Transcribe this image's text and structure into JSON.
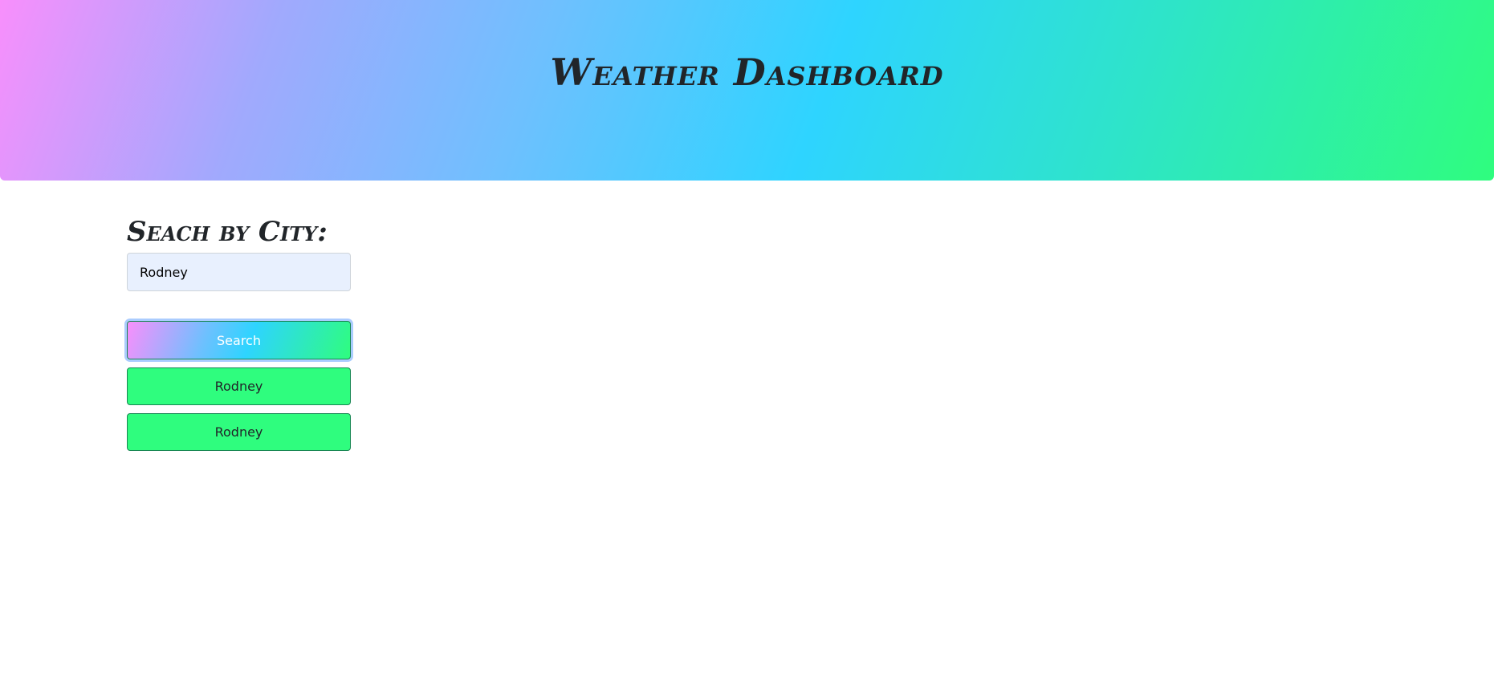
{
  "header": {
    "title": "Weather Dashboard"
  },
  "search": {
    "heading": "Seach by City:",
    "input_value": "Rodney",
    "button_label": "Search"
  },
  "history": {
    "items": [
      {
        "label": "Rodney"
      },
      {
        "label": "Rodney"
      }
    ]
  },
  "colors": {
    "header_gradient_start": "#f88ffc",
    "header_gradient_mid": "#2ed4ff",
    "header_gradient_end": "#2ffd7e",
    "history_button_bg": "#2ffd7e",
    "input_bg": "#e8f0fe",
    "text_dark": "#212529"
  }
}
